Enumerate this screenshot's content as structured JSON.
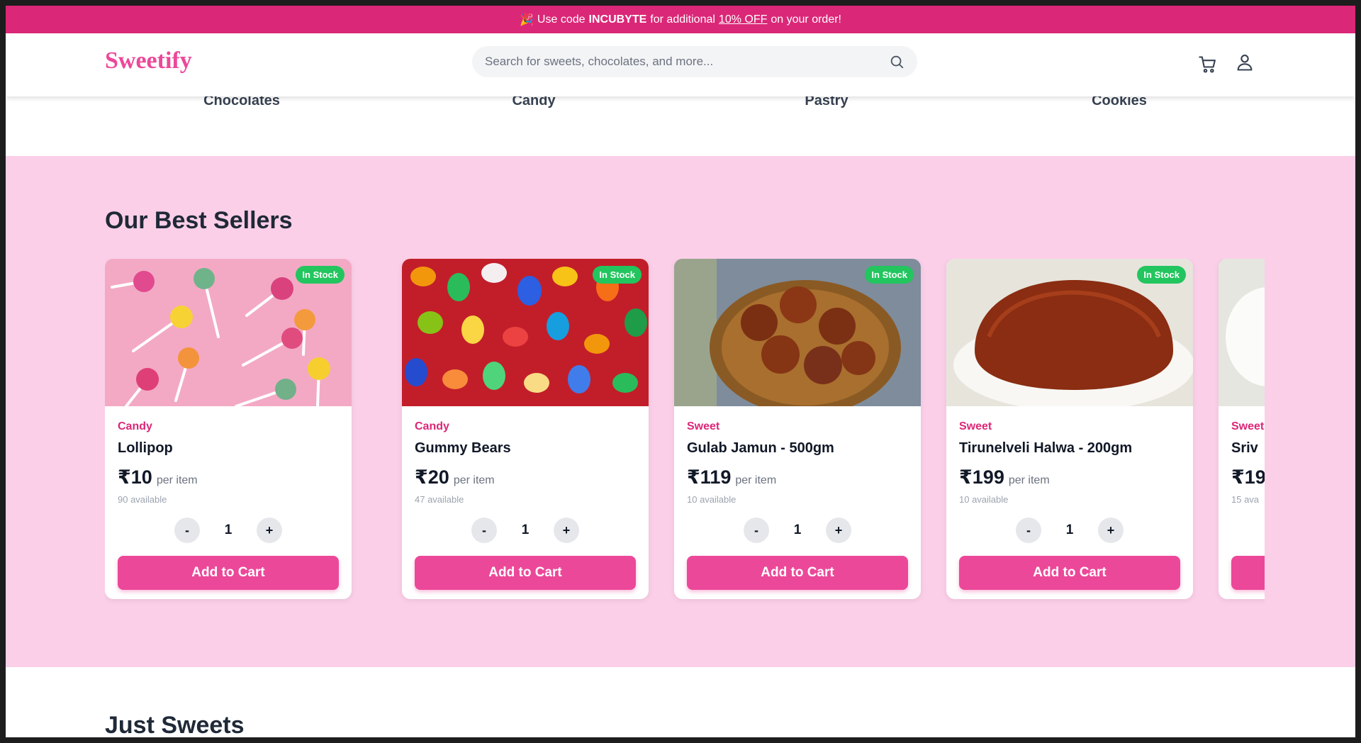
{
  "promo": {
    "emoji": "🎉",
    "text_before": "Use code",
    "code": "INCUBYTE",
    "text_mid": "for additional",
    "discount": "10% OFF",
    "text_after": "on your order!"
  },
  "header": {
    "logo": "Sweetify",
    "search_placeholder": "Search for sweets, chocolates, and more...",
    "icons": [
      "search-icon",
      "cart-icon",
      "user-icon"
    ]
  },
  "categories": [
    "Chocolates",
    "Candy",
    "Pastry",
    "Cookies"
  ],
  "best_sellers": {
    "title": "Our Best Sellers",
    "products": [
      {
        "category": "Candy",
        "name": "Lollipop",
        "price": "₹10",
        "unit": "per item",
        "available": "90 available",
        "stock": "In Stock",
        "qty": "1",
        "minus": "-",
        "plus": "+",
        "cta": "Add to Cart"
      },
      {
        "category": "Candy",
        "name": "Gummy Bears",
        "price": "₹20",
        "unit": "per item",
        "available": "47 available",
        "stock": "In Stock",
        "qty": "1",
        "minus": "-",
        "plus": "+",
        "cta": "Add to Cart"
      },
      {
        "category": "Sweet",
        "name": "Gulab Jamun - 500gm",
        "price": "₹119",
        "unit": "per item",
        "available": "10 available",
        "stock": "In Stock",
        "qty": "1",
        "minus": "-",
        "plus": "+",
        "cta": "Add to Cart"
      },
      {
        "category": "Sweet",
        "name": "Tirunelveli Halwa - 200gm",
        "price": "₹199",
        "unit": "per item",
        "available": "10 available",
        "stock": "In Stock",
        "qty": "1",
        "minus": "-",
        "plus": "+",
        "cta": "Add to Cart"
      },
      {
        "category": "Sweet",
        "name": "Sriv",
        "price": "₹19",
        "unit": "",
        "available": "15 ava",
        "stock": "",
        "qty": "",
        "minus": "",
        "plus": "",
        "cta": ""
      }
    ]
  },
  "just_sweets": {
    "title": "Just Sweets"
  },
  "colors": {
    "brand": "#ec4899",
    "promo_bg": "#db2777",
    "section_bg": "#fbcfe8",
    "stock_badge": "#22c55e"
  }
}
